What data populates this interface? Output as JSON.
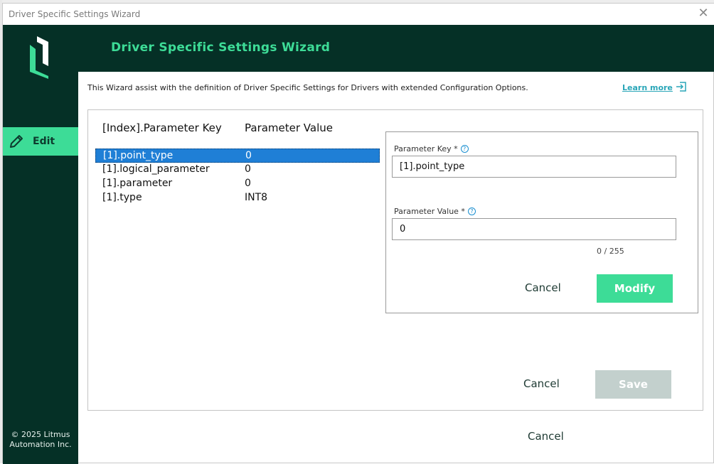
{
  "window": {
    "title": "Driver Specific Settings Wizard",
    "close_glyph": "✕"
  },
  "header": {
    "title": "Driver Specific Settings Wizard"
  },
  "sidebar": {
    "items": [
      {
        "label": "Edit",
        "icon": "pencil-icon"
      }
    ],
    "copyright_line1": "© 2025 Litmus",
    "copyright_line2": "Automation Inc."
  },
  "intro": {
    "text": "This Wizard assist with the definition of Driver Specific Settings for Drivers with extended Configuration Options.",
    "learn_more": "Learn more"
  },
  "table": {
    "headers": {
      "key": "[Index].Parameter Key",
      "value": "Parameter Value"
    },
    "rows": [
      {
        "key": "[1].point_type",
        "value": "0"
      },
      {
        "key": "[1].logical_parameter",
        "value": "0"
      },
      {
        "key": "[1].parameter",
        "value": "0"
      },
      {
        "key": "[1].type",
        "value": "INT8"
      }
    ],
    "selected_index": 0
  },
  "editor": {
    "key_label": "Parameter Key *",
    "key_value": "[1].point_type",
    "value_label": "Parameter Value *",
    "value_value": "0",
    "counter": "0 / 255",
    "cancel": "Cancel",
    "modify": "Modify"
  },
  "footer": {
    "cancel": "Cancel",
    "save": "Save",
    "outer_cancel": "Cancel"
  },
  "colors": {
    "dark": "#053026",
    "accent": "#3ddc97",
    "selection": "#1f7fd6",
    "link": "#2aa6b8",
    "disabled": "#c3d0cd"
  }
}
